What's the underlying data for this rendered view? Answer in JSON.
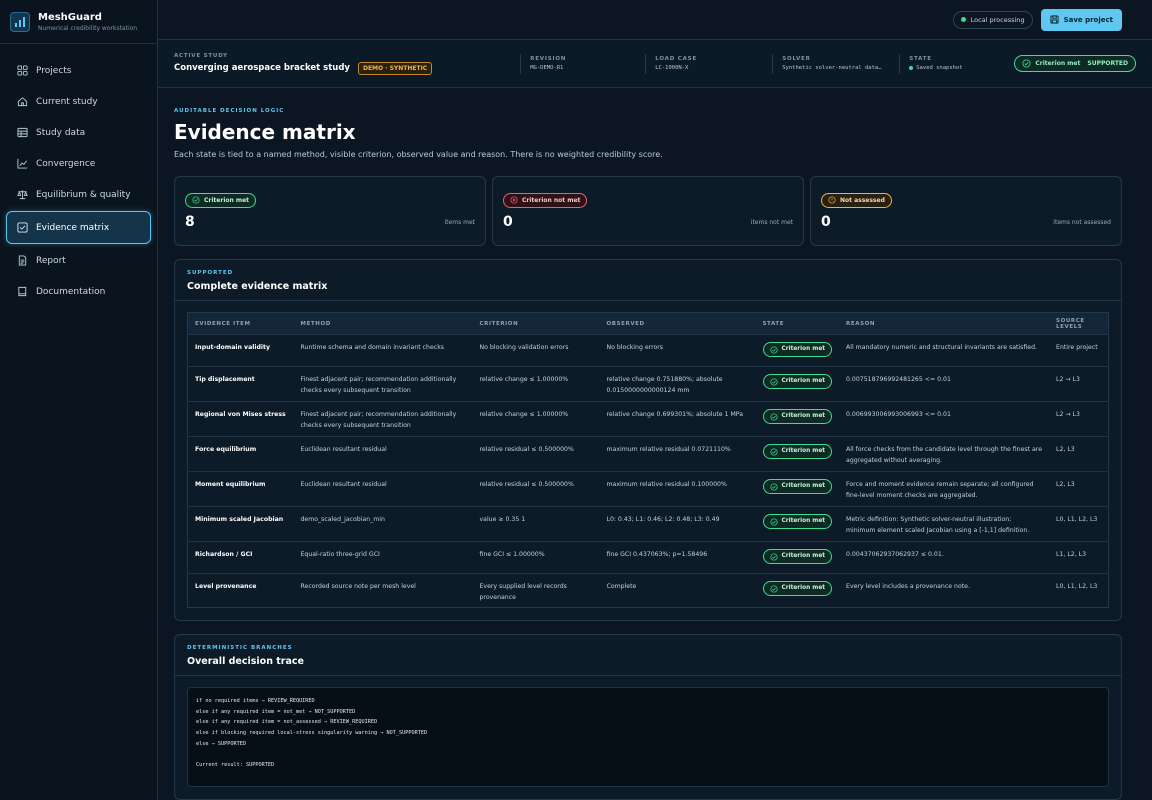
{
  "app": {
    "name": "MeshGuard",
    "subtitle": "Numerical credibility workstation"
  },
  "nav": [
    {
      "label": "Projects",
      "icon": "grid-icon"
    },
    {
      "label": "Current study",
      "icon": "home-icon"
    },
    {
      "label": "Study data",
      "icon": "table-icon"
    },
    {
      "label": "Convergence",
      "icon": "line-chart-icon"
    },
    {
      "label": "Equilibrium & quality",
      "icon": "balance-icon"
    },
    {
      "label": "Evidence matrix",
      "icon": "checkbox-icon",
      "active": true
    },
    {
      "label": "Report",
      "icon": "document-icon"
    },
    {
      "label": "Documentation",
      "icon": "book-icon"
    }
  ],
  "topbar": {
    "local": "Local processing",
    "save": "Save project"
  },
  "study": {
    "active_label": "ACTIVE STUDY",
    "title": "Converging aerospace bracket study",
    "badge": "DEMO · SYNTHETIC",
    "revision_label": "REVISION",
    "revision": "MG-DEMO-R1",
    "loadcase_label": "LOAD CASE",
    "loadcase": "LC-1000N-X",
    "solver_label": "SOLVER",
    "solver": "Synthetic solver-neutral data…",
    "state_label": "STATE",
    "state": "Saved snapshot",
    "status_a": "Criterion met",
    "status_b": "SUPPORTED"
  },
  "header": {
    "eyebrow": "AUDITABLE DECISION LOGIC",
    "title": "Evidence matrix",
    "description": "Each state is tied to a named method, visible criterion, observed value and reason. There is no weighted credibility score."
  },
  "cards": [
    {
      "label": "Criterion met",
      "value": "8",
      "sub": "items met",
      "kind": "met"
    },
    {
      "label": "Criterion not met",
      "value": "0",
      "sub": "items not met",
      "kind": "notmet"
    },
    {
      "label": "Not assessed",
      "value": "0",
      "sub": "items not assessed",
      "kind": "na"
    }
  ],
  "matrix": {
    "eyebrow": "SUPPORTED",
    "title": "Complete evidence matrix",
    "columns": [
      "EVIDENCE ITEM",
      "METHOD",
      "CRITERION",
      "OBSERVED",
      "STATE",
      "REASON",
      "SOURCE LEVELS"
    ],
    "rows": [
      {
        "item": "Input-domain validity",
        "method": "Runtime schema and domain invariant checks",
        "criterion": "No blocking validation errors",
        "observed": "No blocking errors",
        "state": "Criterion met",
        "reason": "All mandatory numeric and structural invariants are satisfied.",
        "levels": "Entire project"
      },
      {
        "item": "Tip displacement",
        "method": "Finest adjacent pair; recommendation additionally checks every subsequent transition",
        "criterion": "relative change ≤ 1.00000%",
        "observed": "relative change 0.751880%; absolute 0.0150000000000124 mm",
        "state": "Criterion met",
        "reason": "0.007518796992481265 <= 0.01",
        "levels": "L2 → L3"
      },
      {
        "item": "Regional von Mises stress",
        "method": "Finest adjacent pair; recommendation additionally checks every subsequent transition",
        "criterion": "relative change ≤ 1.00000%",
        "observed": "relative change 0.699301%; absolute 1 MPa",
        "state": "Criterion met",
        "reason": "0.006993006993006993 <= 0.01",
        "levels": "L2 → L3"
      },
      {
        "item": "Force equilibrium",
        "method": "Euclidean resultant residual",
        "criterion": "relative residual ≤ 0.500000%",
        "observed": "maximum relative residual 0.0721110%",
        "state": "Criterion met",
        "reason": "All force checks from the candidate level through the finest are aggregated without averaging.",
        "levels": "L2, L3"
      },
      {
        "item": "Moment equilibrium",
        "method": "Euclidean resultant residual",
        "criterion": "relative residual ≤ 0.500000%",
        "observed": "maximum relative residual 0.100000%",
        "state": "Criterion met",
        "reason": "Force and moment evidence remain separate; all configured fine-level moment checks are aggregated.",
        "levels": "L2, L3"
      },
      {
        "item": "Minimum scaled Jacobian",
        "method": "demo_scaled_jacobian_min",
        "criterion": "value ≥ 0.35 1",
        "observed": "L0: 0.43; L1: 0.46; L2: 0.48; L3: 0.49",
        "state": "Criterion met",
        "reason": "Metric definition: Synthetic solver-neutral illustration; minimum element scaled Jacobian using a [-1,1] definition.",
        "levels": "L0, L1, L2, L3"
      },
      {
        "item": "Richardson / GCI",
        "method": "Equal-ratio three-grid GCI",
        "criterion": "fine GCI ≤ 1.00000%",
        "observed": "fine GCI 0.437063%; p=1.58496",
        "state": "Criterion met",
        "reason": "0.00437062937062937 ≤ 0.01.",
        "levels": "L1, L2, L3"
      },
      {
        "item": "Level provenance",
        "method": "Recorded source note per mesh level",
        "criterion": "Every supplied level records provenance",
        "observed": "Complete",
        "state": "Criterion met",
        "reason": "Every level includes a provenance note.",
        "levels": "L0, L1, L2, L3"
      }
    ]
  },
  "trace": {
    "eyebrow": "DETERMINISTIC BRANCHES",
    "title": "Overall decision trace",
    "code": "if no required items → REVIEW_REQUIRED\nelse if any required item = not_met → NOT_SUPPORTED\nelse if any required item = not_assessed → REVIEW_REQUIRED\nelse if blocking required local-stress singularity warning → NOT_SUPPORTED\nelse → SUPPORTED\n\nCurrent result: SUPPORTED"
  },
  "colors": {
    "accent": "#5ec8f0",
    "met": "#3ddc97",
    "not_met": "#f05e6e",
    "not_assessed": "#e8b34a",
    "background": "#0b1622"
  }
}
